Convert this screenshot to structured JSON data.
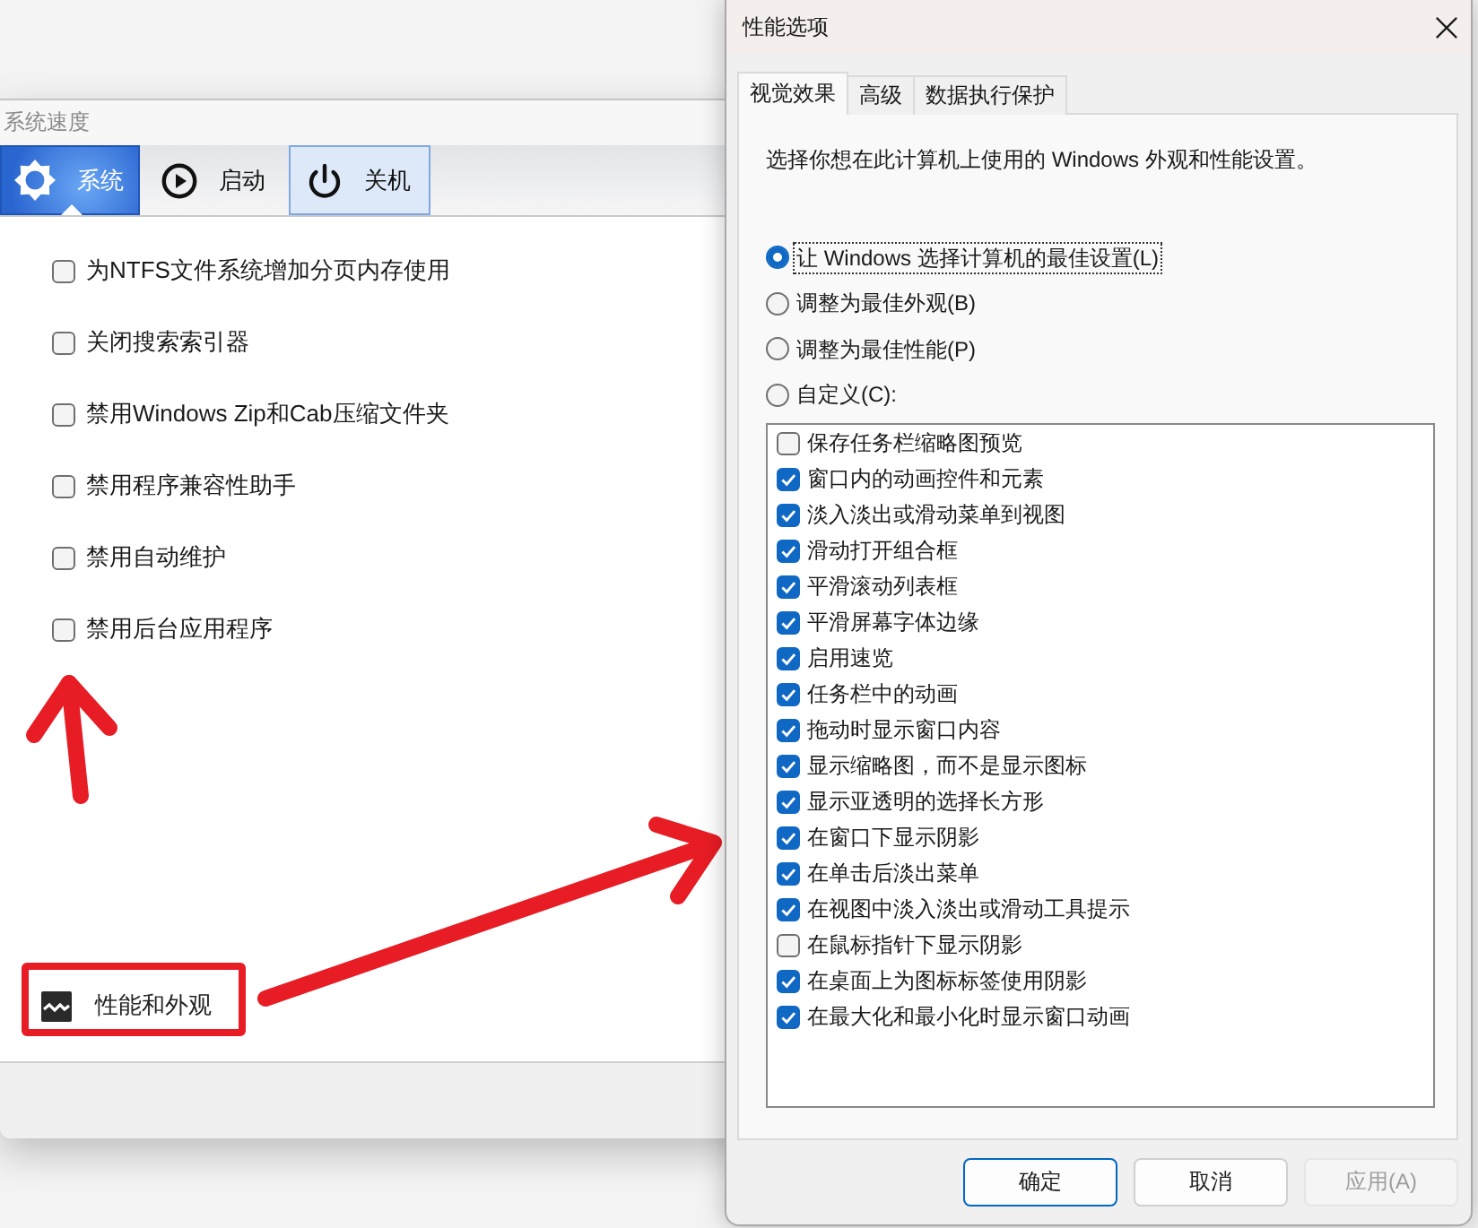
{
  "speed_window": {
    "title": "系统速度",
    "tabs": [
      {
        "label": "系统",
        "selected": true,
        "hovered": false
      },
      {
        "label": "启动",
        "selected": false,
        "hovered": false
      },
      {
        "label": "关机",
        "selected": false,
        "hovered": true
      }
    ],
    "options": [
      {
        "label": "为NTFS文件系统增加分页内存使用",
        "checked": false
      },
      {
        "label": "关闭搜索索引器",
        "checked": false
      },
      {
        "label": "禁用Windows Zip和Cab压缩文件夹",
        "checked": false
      },
      {
        "label": "禁用程序兼容性助手",
        "checked": false
      },
      {
        "label": "禁用自动维护",
        "checked": false
      },
      {
        "label": "禁用后台应用程序",
        "checked": false
      }
    ],
    "footer_button": {
      "label": "性能和外观"
    }
  },
  "performance_dialog": {
    "title": "性能选项",
    "tabs": [
      {
        "label": "视觉效果",
        "selected": true
      },
      {
        "label": "高级",
        "selected": false
      },
      {
        "label": "数据执行保护",
        "selected": false
      }
    ],
    "description": "选择你想在此计算机上使用的 Windows 外观和性能设置。",
    "presets": [
      {
        "label": "让 Windows 选择计算机的最佳设置(L)",
        "selected": true,
        "focused": true
      },
      {
        "label": "调整为最佳外观(B)",
        "selected": false,
        "focused": false
      },
      {
        "label": "调整为最佳性能(P)",
        "selected": false,
        "focused": false
      },
      {
        "label": "自定义(C):",
        "selected": false,
        "focused": false
      }
    ],
    "effects": [
      {
        "label": "保存任务栏缩略图预览",
        "checked": false
      },
      {
        "label": "窗口内的动画控件和元素",
        "checked": true
      },
      {
        "label": "淡入淡出或滑动菜单到视图",
        "checked": true
      },
      {
        "label": "滑动打开组合框",
        "checked": true
      },
      {
        "label": "平滑滚动列表框",
        "checked": true
      },
      {
        "label": "平滑屏幕字体边缘",
        "checked": true
      },
      {
        "label": "启用速览",
        "checked": true
      },
      {
        "label": "任务栏中的动画",
        "checked": true
      },
      {
        "label": "拖动时显示窗口内容",
        "checked": true
      },
      {
        "label": "显示缩略图，而不是显示图标",
        "checked": true
      },
      {
        "label": "显示亚透明的选择长方形",
        "checked": true
      },
      {
        "label": "在窗口下显示阴影",
        "checked": true
      },
      {
        "label": "在单击后淡出菜单",
        "checked": true
      },
      {
        "label": "在视图中淡入淡出或滑动工具提示",
        "checked": true
      },
      {
        "label": "在鼠标指针下显示阴影",
        "checked": false
      },
      {
        "label": "在桌面上为图标标签使用阴影",
        "checked": true
      },
      {
        "label": "在最大化和最小化时显示窗口动画",
        "checked": true
      }
    ],
    "buttons": [
      {
        "label": "确定",
        "default": true,
        "disabled": false
      },
      {
        "label": "取消",
        "default": false,
        "disabled": false
      },
      {
        "label": "应用(A)",
        "default": false,
        "disabled": true
      }
    ]
  }
}
